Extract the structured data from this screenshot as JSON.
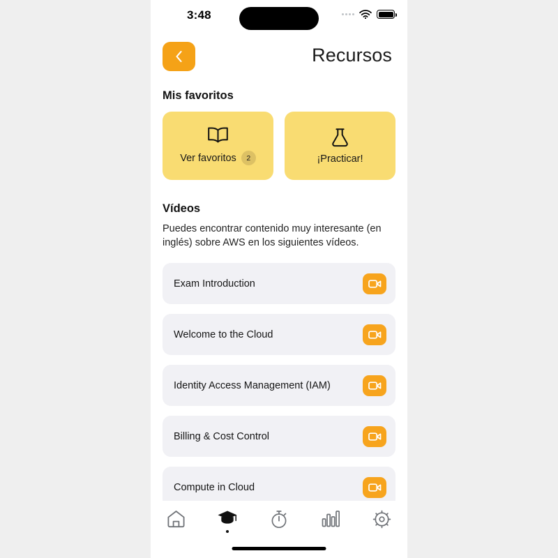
{
  "status_bar": {
    "time": "3:48",
    "signal_icon": "signal-dots-icon",
    "wifi_icon": "wifi-icon",
    "battery_icon": "battery-full-icon"
  },
  "header": {
    "back_icon": "chevron-left-icon",
    "title": "Recursos"
  },
  "favorites": {
    "section_title": "Mis favoritos",
    "cards": [
      {
        "label": "Ver favoritos",
        "icon": "open-book-icon",
        "badge": "2"
      },
      {
        "label": "¡Practicar!",
        "icon": "flask-icon",
        "badge": ""
      }
    ]
  },
  "videos": {
    "section_title": "Vídeos",
    "description": "Puedes encontrar contenido muy interesante (en inglés) sobre AWS en los siguientes vídeos.",
    "items": [
      {
        "title": "Exam Introduction",
        "icon": "video-camera-icon"
      },
      {
        "title": "Welcome to the Cloud",
        "icon": "video-camera-icon"
      },
      {
        "title": "Identity Access Management (IAM)",
        "icon": "video-camera-icon"
      },
      {
        "title": "Billing & Cost Control",
        "icon": "video-camera-icon"
      },
      {
        "title": "Compute in Cloud",
        "icon": "video-camera-icon"
      }
    ]
  },
  "tab_bar": {
    "tabs": [
      {
        "name": "home",
        "icon": "house-icon",
        "active": false
      },
      {
        "name": "learn",
        "icon": "graduation-cap-icon",
        "active": true
      },
      {
        "name": "timer",
        "icon": "stopwatch-icon",
        "active": false
      },
      {
        "name": "stats",
        "icon": "bar-chart-icon",
        "active": false
      },
      {
        "name": "settings",
        "icon": "gear-icon",
        "active": false
      }
    ]
  },
  "colors": {
    "accent_orange": "#f5a217",
    "card_yellow": "#f9dc72",
    "badge_yellow": "#ddc164",
    "row_gray": "#f1f1f5",
    "page_background": "#efefef"
  }
}
